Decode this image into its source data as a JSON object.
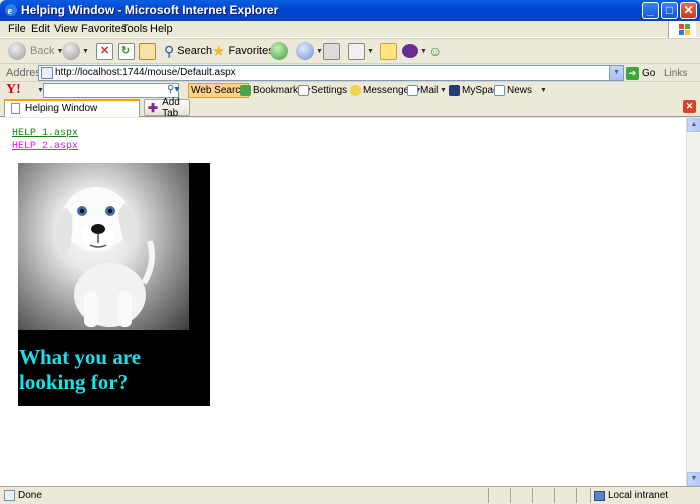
{
  "window": {
    "title": "Helping Window - Microsoft Internet Explorer",
    "minimize": "_",
    "maximize": "□",
    "close": "✕"
  },
  "menu": [
    "File",
    "Edit",
    "View",
    "Favorites",
    "Tools",
    "Help"
  ],
  "toolbar": {
    "back": "Back",
    "search": "Search",
    "favorites": "Favorites"
  },
  "address": {
    "label": "Address",
    "url": "http://localhost:1744/mouse/Default.aspx",
    "go": "Go",
    "links": "Links"
  },
  "yahoo": {
    "logo": "Y!",
    "search_value": "",
    "web_search": "Web Search",
    "bookmarks": "Bookmarks",
    "settings": "Settings",
    "messenger": "Messenger",
    "mail": "Mail",
    "myspace": "MySpace",
    "news": "News"
  },
  "tabs": {
    "active": "Helping Window",
    "add": "Add Tab"
  },
  "page": {
    "links": [
      "HELP 1.aspx",
      "HELP 2.aspx"
    ],
    "promo_caption": "What you are looking for?"
  },
  "status": {
    "text": "Done",
    "zone": "Local intranet"
  },
  "colors": {
    "link1": "#118311",
    "link2": "#E01BE0",
    "caption": "#18E1EC",
    "titlebar": "#0346D5"
  }
}
